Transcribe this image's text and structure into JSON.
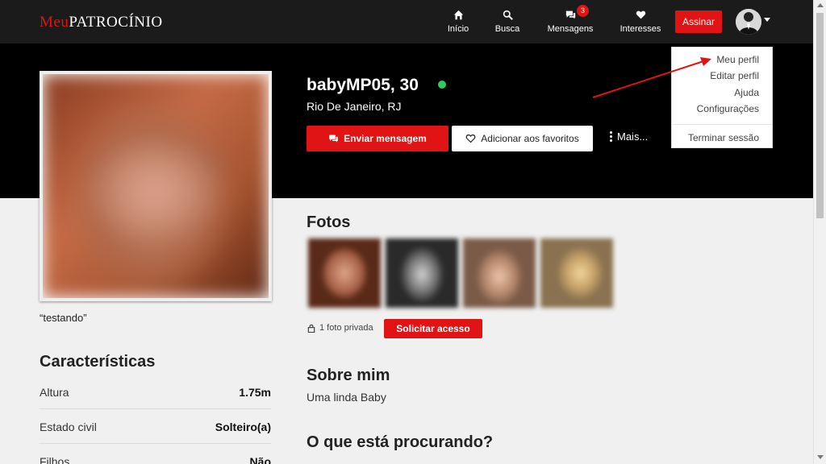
{
  "brand": {
    "part1": "Meu",
    "part2": "Patrocínio"
  },
  "nav": {
    "inicio": "Início",
    "busca": "Busca",
    "mensagens": "Mensagens",
    "mensagens_badge": "3",
    "interesses": "Interesses",
    "assinar": "Assinar"
  },
  "dropdown": {
    "items": [
      "Meu perfil",
      "Editar perfil",
      "Ajuda",
      "Configurações"
    ],
    "logout": "Terminar sessão"
  },
  "profile": {
    "name": "babyMP05, 30",
    "location": "Rio De Janeiro, RJ",
    "quote": "“testando”",
    "online_color": "#2ecc5a"
  },
  "actions": {
    "message": "Enviar mensagem",
    "favorite": "Adicionar aos favoritos",
    "more": "Mais..."
  },
  "photos": {
    "title": "Fotos",
    "private_text": "1 foto privada",
    "request_access": "Solicitar acesso"
  },
  "characteristics": {
    "title": "Características",
    "rows": [
      {
        "label": "Altura",
        "value": "1.75m"
      },
      {
        "label": "Estado civil",
        "value": "Solteiro(a)"
      },
      {
        "label": "Filhos",
        "value": "Não"
      }
    ]
  },
  "about": {
    "title": "Sobre mim",
    "text": "Uma linda Baby"
  },
  "looking": {
    "title": "O que está procurando?"
  },
  "colors": {
    "accent": "#e01414",
    "topbar": "#1b1b1b",
    "hero": "#000000"
  }
}
